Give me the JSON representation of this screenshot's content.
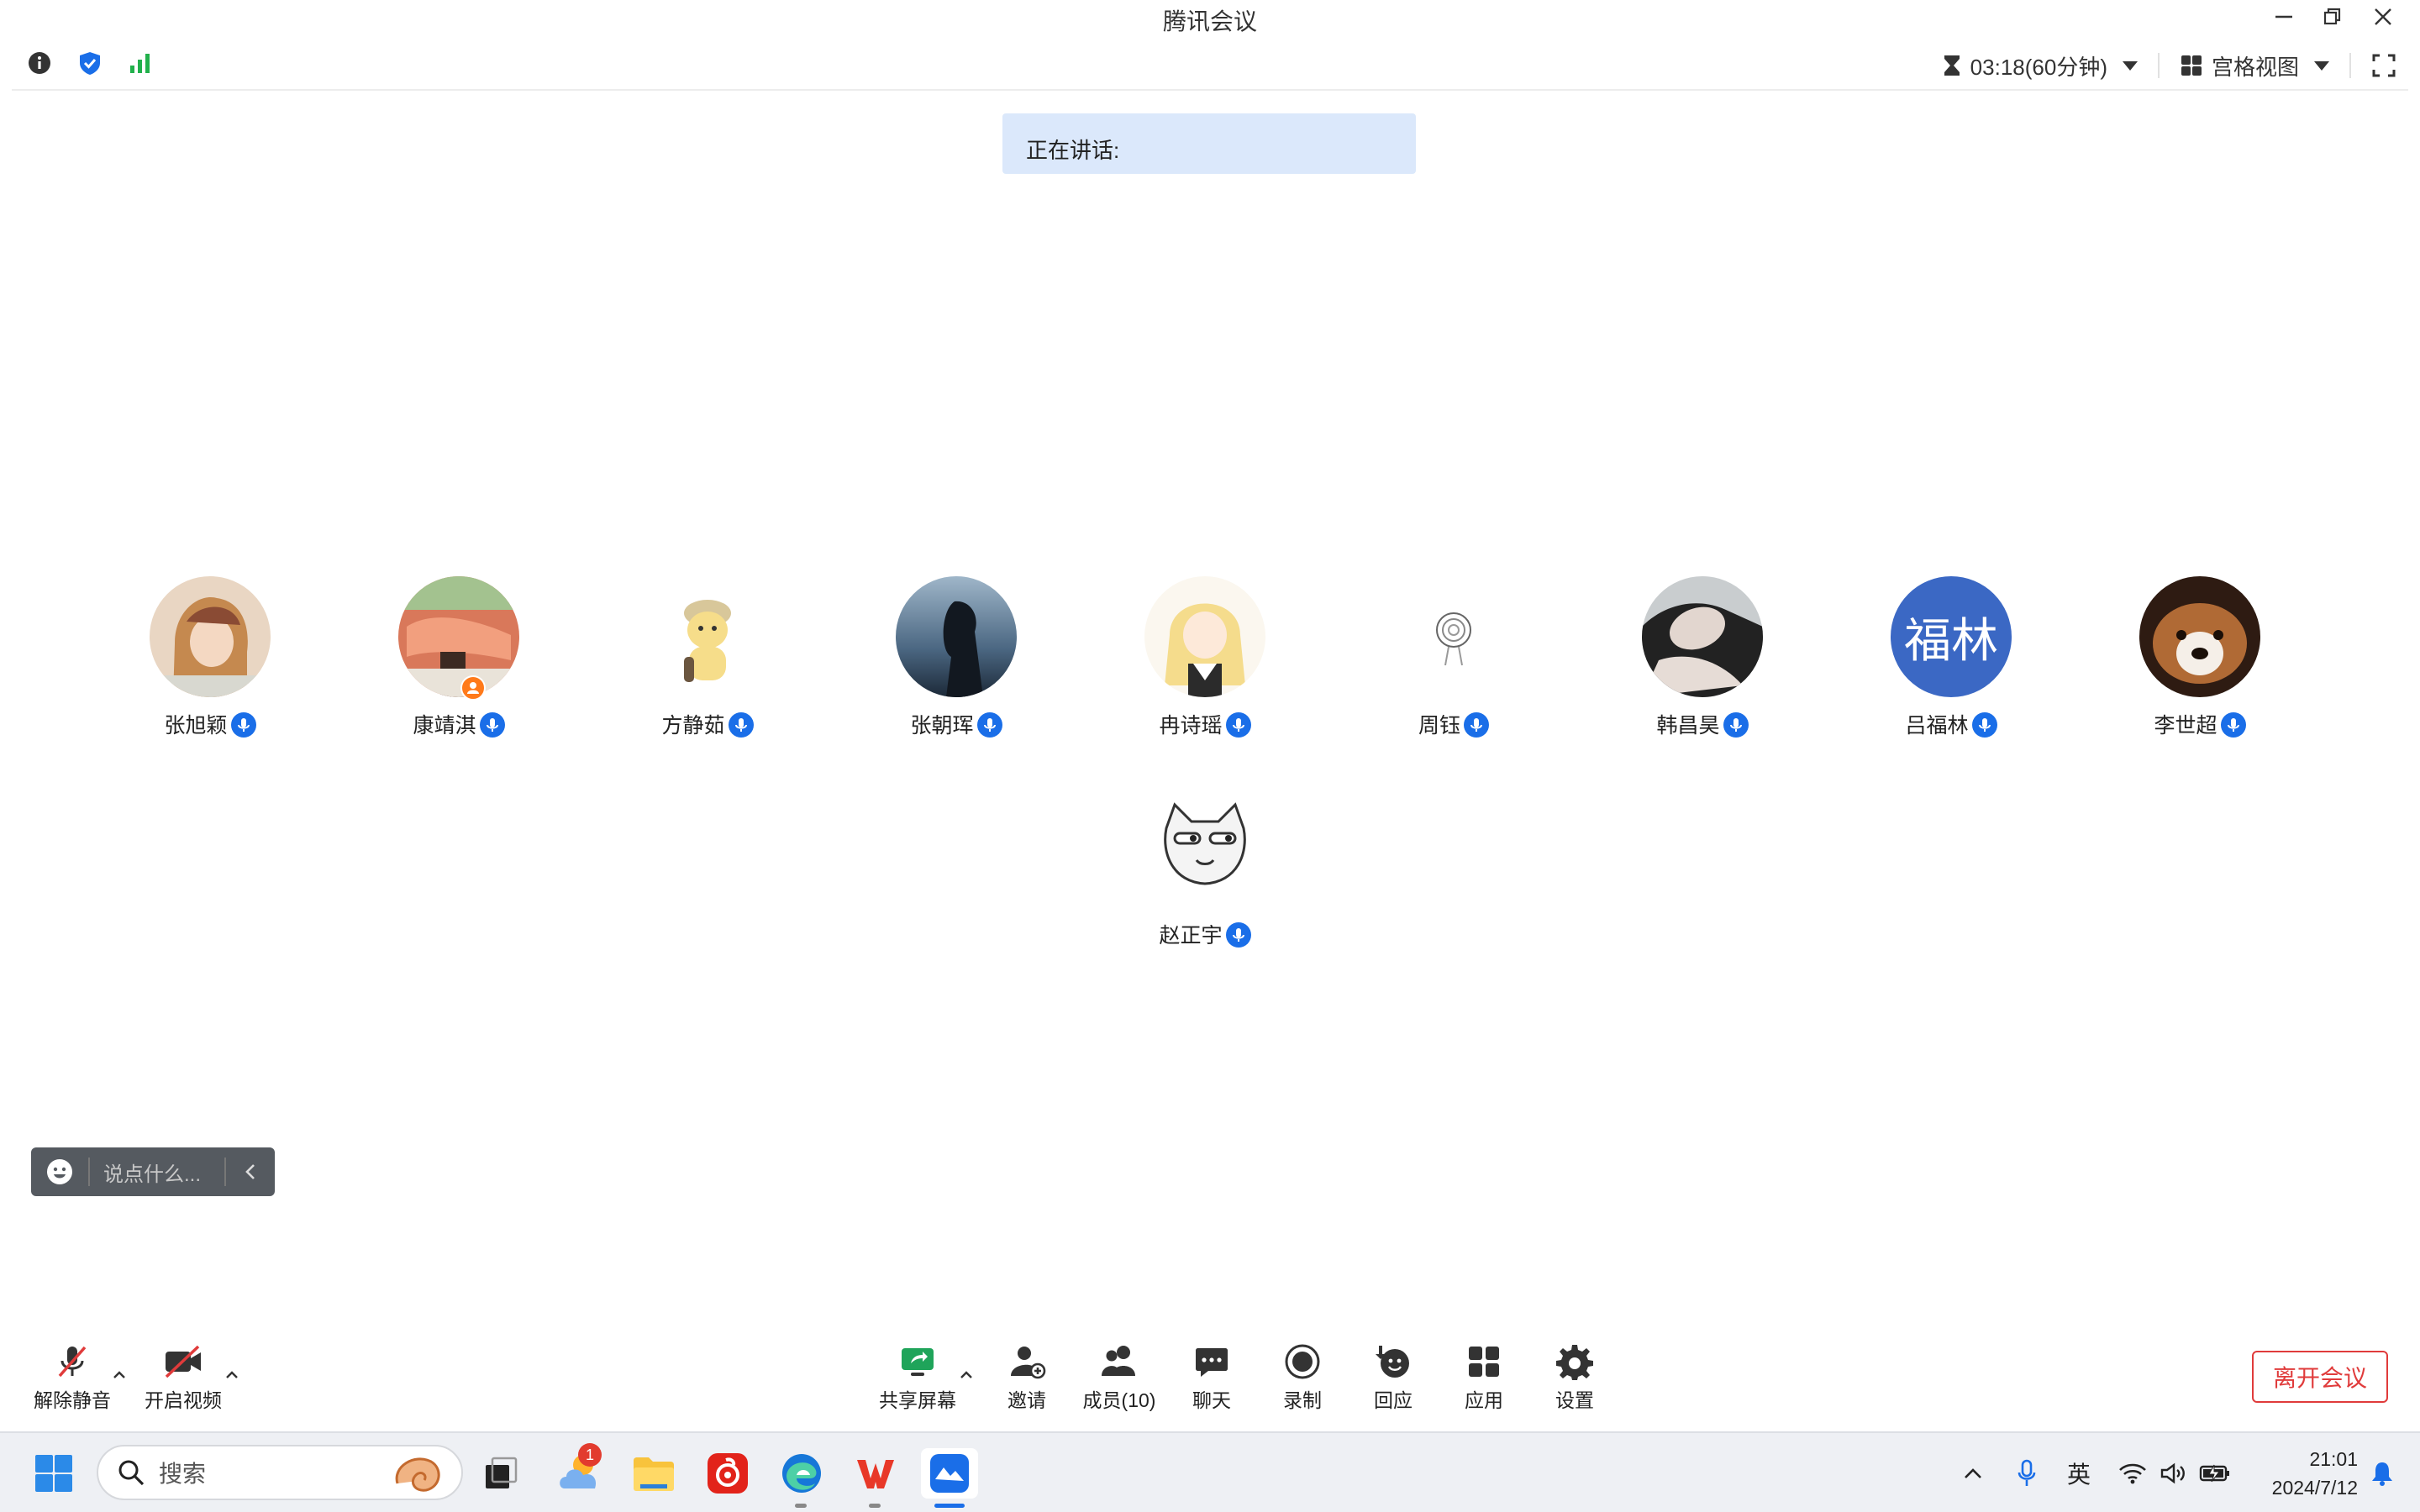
{
  "window": {
    "title": "腾讯会议"
  },
  "toolbar": {
    "timer": "03:18(60分钟)",
    "view_mode": "宫格视图"
  },
  "speaking": {
    "label": "正在讲话:"
  },
  "participants": [
    {
      "name": "张旭颖",
      "avatar_color": "#caa27a"
    },
    {
      "name": "康靖淇",
      "avatar_color": "#d9785a"
    },
    {
      "name": "方静茹",
      "avatar_color": "#f4e3a3"
    },
    {
      "name": "张朝珲",
      "avatar_color": "#3d5a7a"
    },
    {
      "name": "冉诗瑶",
      "avatar_color": "#f5e4b2"
    },
    {
      "name": "周钰",
      "avatar_color": "#e8e8e8"
    },
    {
      "name": "韩昌昊",
      "avatar_color": "#8b8f92"
    },
    {
      "name": "吕福林",
      "avatar_text": "福林",
      "avatar_color": "#3b68c4"
    },
    {
      "name": "李世超",
      "avatar_color": "#7a4e2c"
    },
    {
      "name": "赵正宇",
      "avatar_color": "#f2f2f2"
    }
  ],
  "chat": {
    "placeholder": "说点什么..."
  },
  "controls": {
    "unmute": "解除静音",
    "start_video": "开启视频",
    "share_screen": "共享屏幕",
    "invite": "邀请",
    "members": "成员(10)",
    "chat": "聊天",
    "record": "录制",
    "react": "回应",
    "apps": "应用",
    "settings": "设置",
    "leave": "离开会议"
  },
  "taskbar": {
    "search_placeholder": "搜索",
    "weather_badge": "1",
    "ime": "英",
    "time": "21:01",
    "date": "2024/7/12"
  },
  "colors": {
    "accent": "#1a6ee8",
    "danger": "#e03b3b",
    "speaking_bg": "#dbe8fb",
    "signal": "#22b14c"
  }
}
